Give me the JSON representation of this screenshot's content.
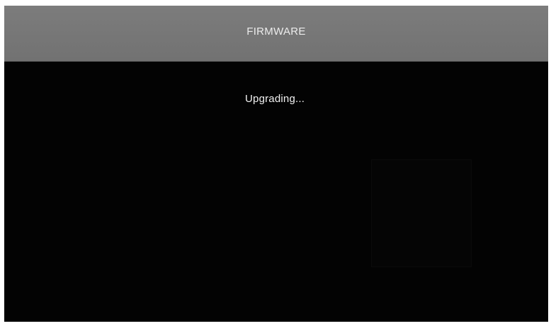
{
  "header": {
    "title": "FIRMWARE"
  },
  "status": {
    "message": "Upgrading..."
  }
}
